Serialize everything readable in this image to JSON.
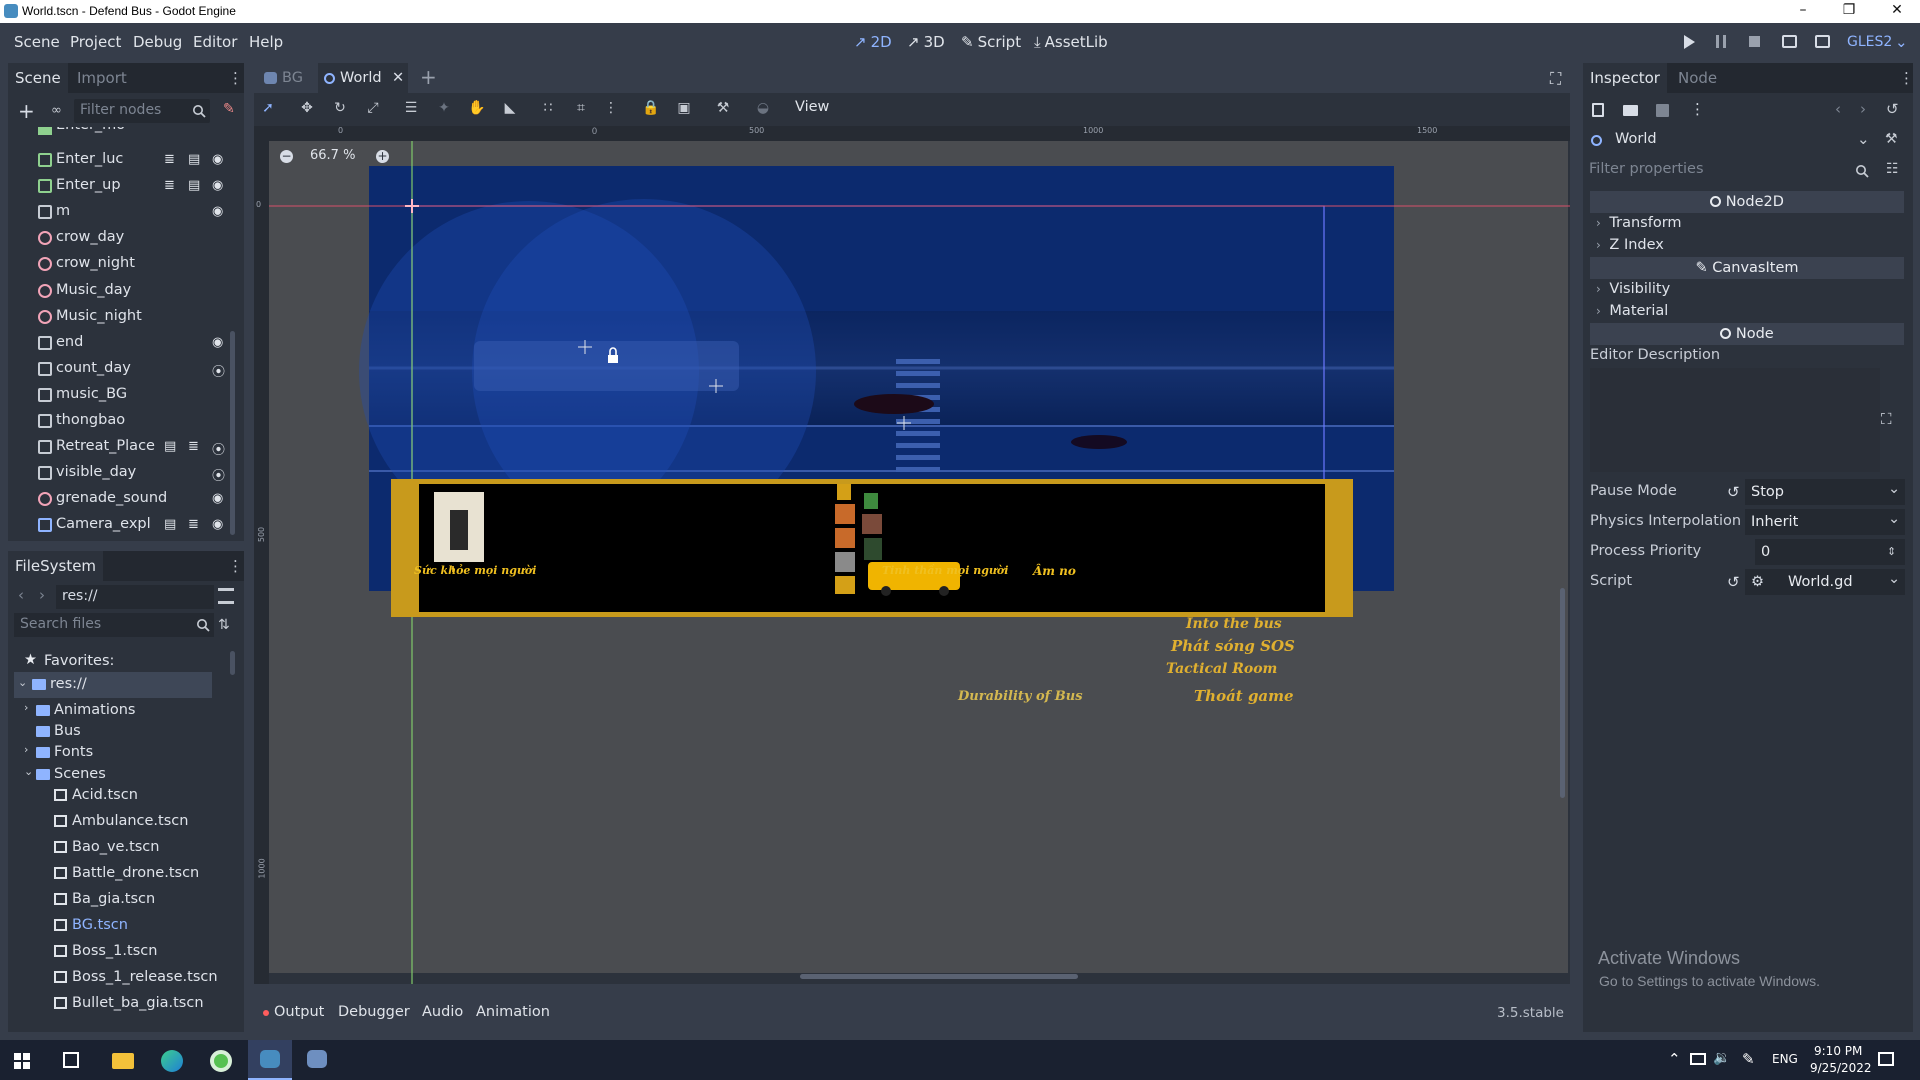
{
  "window": {
    "title": "World.tscn - Defend Bus - Godot Engine"
  },
  "menu": {
    "items": [
      "Scene",
      "Project",
      "Debug",
      "Editor",
      "Help"
    ]
  },
  "workspaces": {
    "items": [
      "2D",
      "3D",
      "Script",
      "AssetLib"
    ],
    "active": "2D",
    "renderer": "GLES2"
  },
  "scene_dock": {
    "tabs": [
      "Scene",
      "Import"
    ],
    "filter_placeholder": "Filter nodes",
    "nodes": [
      {
        "name": "Enter_luc",
        "icon": "sprite-icon"
      },
      {
        "name": "Enter_up",
        "icon": "sprite-icon"
      },
      {
        "name": "m",
        "icon": "position-icon"
      },
      {
        "name": "crow_day",
        "icon": "audio-icon"
      },
      {
        "name": "crow_night",
        "icon": "audio-icon"
      },
      {
        "name": "Music_day",
        "icon": "audio-icon"
      },
      {
        "name": "Music_night",
        "icon": "audio-icon"
      },
      {
        "name": "end",
        "icon": "position-icon"
      },
      {
        "name": "count_day",
        "icon": "timer-icon"
      },
      {
        "name": "music_BG",
        "icon": "timer-icon"
      },
      {
        "name": "thongbao",
        "icon": "timer-icon"
      },
      {
        "name": "Retreat_Place",
        "icon": "area-icon"
      },
      {
        "name": "visible_day",
        "icon": "timer-icon"
      },
      {
        "name": "grenade_sound",
        "icon": "audio-icon"
      },
      {
        "name": "Camera_expl",
        "icon": "camera-icon"
      }
    ]
  },
  "filesystem_dock": {
    "title": "FileSystem",
    "path": "res://",
    "search_placeholder": "Search files",
    "favorites_label": "Favorites:",
    "root_label": "res://",
    "folders": [
      "Animations",
      "Bus",
      "Fonts",
      "Scenes"
    ],
    "files": [
      "Acid.tscn",
      "Ambulance.tscn",
      "Bao_ve.tscn",
      "Battle_drone.tscn",
      "Ba_gia.tscn",
      "BG.tscn",
      "Boss_1.tscn",
      "Boss_1_release.tscn",
      "Bullet_ba_gia.tscn"
    ]
  },
  "editor_tabs": {
    "items": [
      "BG",
      "World"
    ],
    "active": "World"
  },
  "viewport": {
    "toolbar_view_label": "View",
    "zoom": "66.7 %",
    "ruler_top": [
      "0",
      "500",
      "1000",
      "1500"
    ],
    "ruler_left": [
      "0",
      "500",
      "1000"
    ],
    "game_texts": {
      "left_caption": "Sức khỏe mọi người",
      "center_caption": "Tinh thần mọi người",
      "hunger_caption": "Âm no",
      "durability": "Durability of Bus",
      "menu_options": [
        "Into the bus",
        "Phát sóng SOS",
        "Tactical Room",
        "Thoát game"
      ]
    }
  },
  "bottom_panel": {
    "tabs": [
      "Output",
      "Debugger",
      "Audio",
      "Animation"
    ],
    "version": "3.5.stable"
  },
  "inspector": {
    "tabs": [
      "Inspector",
      "Node"
    ],
    "selected_node": "World",
    "filter_placeholder": "Filter properties",
    "sections": {
      "node2d": "Node2D",
      "transform": "Transform",
      "zindex": "Z Index",
      "canvasitem": "CanvasItem",
      "visibility": "Visibility",
      "material": "Material",
      "node": "Node",
      "editor_description": "Editor Description"
    },
    "properties": {
      "pause_mode": {
        "label": "Pause Mode",
        "value": "Stop"
      },
      "physics_interp": {
        "label": "Physics Interpolation",
        "value": "Inherit"
      },
      "process_priority": {
        "label": "Process Priority",
        "value": "0"
      },
      "script": {
        "label": "Script",
        "value": "World.gd"
      }
    }
  },
  "activation": {
    "title": "Activate Windows",
    "subtitle": "Go to Settings to activate Windows."
  },
  "taskbar": {
    "lang": "ENG",
    "time": "9:10 PM",
    "date": "9/25/2022"
  },
  "colors": {
    "editor_bg": "#363d4a",
    "panel": "#2c323c",
    "accent": "#8fb4ff",
    "viewport": "#4a4c50",
    "scene_blue": "#0c2a6e",
    "hud_gold": "#d4a017"
  }
}
